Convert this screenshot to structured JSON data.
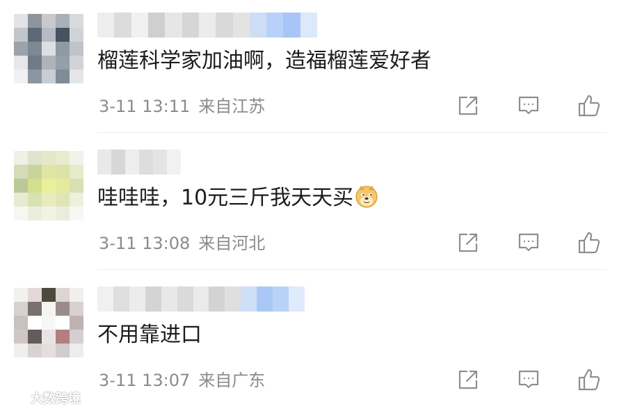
{
  "comments": [
    {
      "text": "榴莲科学家加油啊，造福榴莲爱好者",
      "time": "3-11 13:11",
      "location": "来自江苏",
      "avatar_colors": [
        "#e2e3e5",
        "#8d949c",
        "#c7c9cc",
        "#a8b0b8",
        "#d8dade",
        "#c2c6cb",
        "#5c6a77",
        "#b5bbc2",
        "#44535f",
        "#cfd3d7",
        "#9aa2aa",
        "#7d8893",
        "#dde0e3",
        "#8f99a3",
        "#bfc4c9",
        "#e6e7e9",
        "#6f7b86",
        "#adb4bb",
        "#93a0a9",
        "#d0d4d8",
        "#f0f1f2",
        "#8a97a0",
        "#c9cdd1",
        "#7e8c97",
        "#e4e6e8"
      ],
      "name_colors": [
        "#eeeeee",
        "#dcdcdc",
        "#f1f1f1",
        "#cfcfcf",
        "#e6e6e6",
        "#d6d6d6",
        "#ececec",
        "#d9d9d9",
        "#e3e3e3",
        "#cdddf6",
        "#b8d1f8",
        "#a7c6f7",
        "#dce8fb"
      ]
    },
    {
      "text": "哇哇哇，10元三斤我天天买",
      "time": "3-11 13:08",
      "location": "来自河北",
      "avatar_colors": [
        "#eff0e6",
        "#dfe4cc",
        "#e4e8c8",
        "#e8eccd",
        "#f1f2e8",
        "#d6dcb6",
        "#c8d49a",
        "#dfe6a4",
        "#dbe3a7",
        "#e6ebca",
        "#b9c998",
        "#d3df8f",
        "#ecef9a",
        "#e6ea9f",
        "#d8e0b3",
        "#e7ebd5",
        "#d9e1b1",
        "#e8ebbf",
        "#dfe5b7",
        "#eef0de",
        "#f6f7f0",
        "#eceedc",
        "#f2f3e4",
        "#ebeddc",
        "#f7f8f2"
      ],
      "name_colors": [
        "#e9e9e9",
        "#d7d7d7",
        "#eeeeee",
        "#dddddd",
        "#e4e4e4",
        "#f2f2f2"
      ]
    },
    {
      "text": "不用靠进口",
      "time": "3-11 13:07",
      "location": "来自广东",
      "avatar_colors": [
        "#f3f0f0",
        "#e3d8d8",
        "#4d4a3c",
        "#ddd4d4",
        "#f2eeee",
        "#d8cfcf",
        "#7a6f6f",
        "#f4f4f4",
        "#9a8c8c",
        "#d9d1d1",
        "#c9c0c0",
        "#ffffff",
        "#f7f7f7",
        "#ffffff",
        "#bdb3b3",
        "#cfc7c7",
        "#625c5c",
        "#e9e4e4",
        "#b37d82",
        "#d6cfcf",
        "#f1eeee",
        "#d9d2d2",
        "#e4dede",
        "#d3cccc",
        "#efecec"
      ],
      "name_colors": [
        "#f0f0f0",
        "#dedede",
        "#ececec",
        "#d4d4d4",
        "#e8e8e8",
        "#dadada",
        "#eaeaea",
        "#d3d3d3",
        "#dfdfdf",
        "#cde0f8",
        "#a9c8f6",
        "#b8d2f8",
        "#dfeafb"
      ]
    }
  ],
  "watermark": {
    "text": "大数跨境"
  },
  "icons": {
    "share": "share-icon",
    "reply": "comment-icon",
    "like": "thumbs-up-icon",
    "emoji": "doge-emoji-icon"
  }
}
